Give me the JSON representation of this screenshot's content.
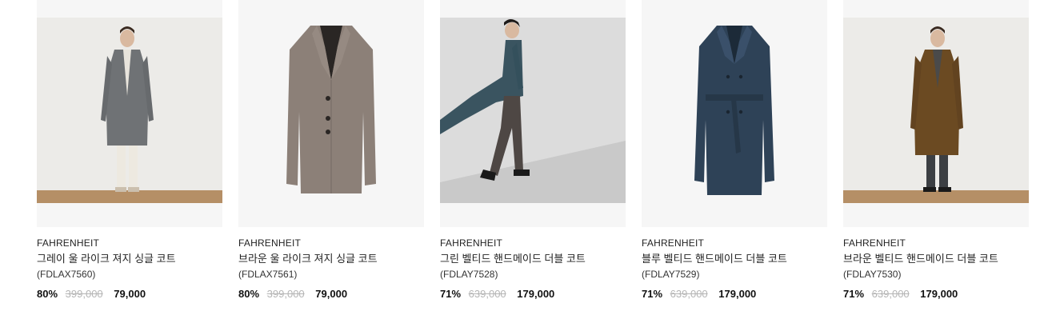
{
  "products": [
    {
      "brand": "FAHRENHEIT",
      "name": "그레이 울 라이크 져지 싱글 코트",
      "code": "(FDLAX7560)",
      "discount": "80%",
      "original_price": "399,000",
      "sale_price": "79,000",
      "image_type": "model-photo",
      "coat_color": "#6f7275",
      "bg_color": "#ecebe8"
    },
    {
      "brand": "FAHRENHEIT",
      "name": "브라운 울 라이크 져지 싱글 코트",
      "code": "(FDLAX7561)",
      "discount": "80%",
      "original_price": "399,000",
      "sale_price": "79,000",
      "image_type": "flat-coat",
      "coat_color": "#8c8078",
      "bg_color": "#f6f6f6"
    },
    {
      "brand": "FAHRENHEIT",
      "name": "그린 벨티드 핸드메이드 더블 코트",
      "code": "(FDLAY7528)",
      "discount": "71%",
      "original_price": "639,000",
      "sale_price": "179,000",
      "image_type": "model-walking",
      "coat_color": "#3a5460",
      "bg_color": "#dcdcdc"
    },
    {
      "brand": "FAHRENHEIT",
      "name": "블루 벨티드 핸드메이드 더블 코트",
      "code": "(FDLAY7529)",
      "discount": "71%",
      "original_price": "639,000",
      "sale_price": "179,000",
      "image_type": "flat-belted-coat",
      "coat_color": "#2e4257",
      "bg_color": "#f6f6f6"
    },
    {
      "brand": "FAHRENHEIT",
      "name": "브라운 벨티드 핸드메이드 더블 코트",
      "code": "(FDLAY7530)",
      "discount": "71%",
      "original_price": "639,000",
      "sale_price": "179,000",
      "image_type": "model-photo",
      "coat_color": "#6b4a22",
      "bg_color": "#ecebe8"
    }
  ]
}
